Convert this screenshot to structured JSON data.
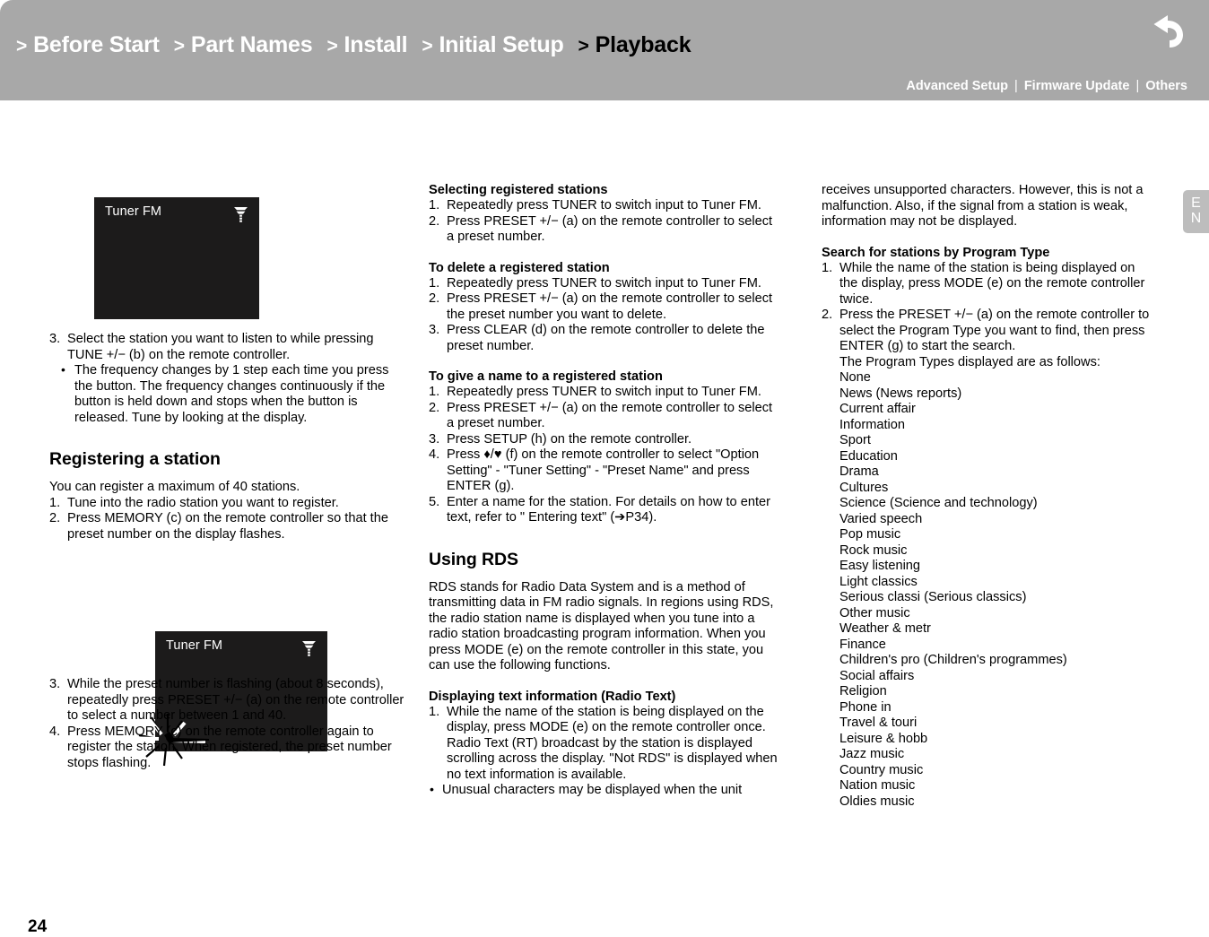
{
  "header": {
    "breadcrumbs": [
      {
        "label": "Before Start",
        "chevron": ">",
        "active": false
      },
      {
        "label": "Part Names",
        "chevron": ">",
        "active": false
      },
      {
        "label": "Install",
        "chevron": ">",
        "active": false
      },
      {
        "label": "Initial Setup",
        "chevron": ">",
        "active": false
      },
      {
        "label": "Playback",
        "chevron": ">",
        "active": true
      }
    ],
    "links": [
      {
        "label": "Advanced Setup"
      },
      {
        "label": "Firmware Update"
      },
      {
        "label": "Others"
      }
    ],
    "link_separator": "|",
    "back_icon": "back-arrow-icon",
    "bg_color": "#a8a8a8",
    "text_color": "#ffffff",
    "active_color": "#000000"
  },
  "side_tab": {
    "line1": "E",
    "line2": "N",
    "bg_color": "#bdbdbd"
  },
  "figures": {
    "figure1": {
      "label": "Tuner FM",
      "icon": "antenna-signal-icon"
    },
    "figure2": {
      "label": "Tuner FM",
      "icon": "antenna-signal-icon",
      "effect": "flashing-sparkle"
    }
  },
  "left_column": {
    "step3": {
      "num": "3.",
      "text": "Select the station you want to listen to while pressing TUNE +/− (b) on the remote controller."
    },
    "step3_bullet": "The frequency changes by 1 step each time you press the button. The frequency changes continuously if the button is held down and stops when the button is released. Tune by looking at the display.",
    "registering_heading": "Registering a station",
    "registering_intro": "You can register a maximum of 40 stations.",
    "registering_steps": [
      {
        "num": "1.",
        "text": "Tune into the radio station you want to register."
      },
      {
        "num": "2.",
        "text": "Press MEMORY (c) on the remote controller so that the preset number on the display flashes."
      }
    ],
    "registering_steps_after": [
      {
        "num": "3.",
        "text": "While the preset number is flashing (about 8 seconds), repeatedly press PRESET +/− (a) on the remote controller to select a number between 1 and 40."
      },
      {
        "num": "4.",
        "text": "Press MEMORY (c) on the remote controller again to register the station. When registered, the preset number stops flashing."
      }
    ]
  },
  "middle_column": {
    "selecting_heading": "Selecting registered stations",
    "selecting_steps": [
      {
        "num": "1.",
        "text": "Repeatedly press TUNER to switch input to Tuner FM."
      },
      {
        "num": "2.",
        "text": "Press PRESET +/− (a) on the remote controller to select a preset number."
      }
    ],
    "delete_heading": "To delete a registered station",
    "delete_steps": [
      {
        "num": "1.",
        "text": "Repeatedly press TUNER to switch input to Tuner FM."
      },
      {
        "num": "2.",
        "text": "Press PRESET +/− (a) on the remote controller to select the preset number you want to delete."
      },
      {
        "num": "3.",
        "text": "Press CLEAR (d) on the remote controller to delete the preset number."
      }
    ],
    "name_heading": "To give a name to a registered station",
    "name_steps": [
      {
        "num": "1.",
        "text": "Repeatedly press TUNER to switch input to Tuner FM."
      },
      {
        "num": "2.",
        "text": "Press PRESET +/− (a) on the remote controller to select a preset number."
      },
      {
        "num": "3.",
        "text": "Press SETUP (h) on the remote controller."
      },
      {
        "num": "4.",
        "text": "Press ♦/♥ (f) on the remote controller to select \"Option Setting\" - \"Tuner Setting\" - \"Preset Name\" and press ENTER (g)."
      },
      {
        "num": "5.",
        "text": "Enter a name for the station. For details on how to enter text, refer to \" Entering text\" (➔P34)."
      }
    ],
    "rds_heading": "Using RDS",
    "rds_body": "RDS stands for Radio Data System and is a method of transmitting data in FM radio signals. In regions using RDS, the radio station name is displayed when you tune into a radio station broadcasting program information. When you press MODE (e) on the remote controller in this state, you can use the following functions.",
    "radiotext_heading": "Displaying text information (Radio Text)",
    "radiotext_step1": {
      "num": "1.",
      "text": "While the name of the station is being displayed on the display, press MODE (e) on the remote controller once. Radio Text (RT) broadcast by the station is displayed scrolling across the display. \"Not RDS\" is displayed when no text information is available."
    },
    "radiotext_bullet_part1": "Unusual characters may be displayed when the unit"
  },
  "right_column": {
    "continued_text": "receives unsupported characters. However, this is not a malfunction. Also, if the signal from a station is weak, information may not be displayed.",
    "program_type_heading": "Search for stations by Program Type",
    "program_type_steps": [
      {
        "num": "1.",
        "text": "While the name of the station is being displayed on the display, press MODE (e) on the remote controller twice."
      },
      {
        "num": "2.",
        "text": "Press the PRESET +/− (a) on the remote controller to select the Program Type you want to find, then press ENTER (g) to start the search."
      }
    ],
    "program_type_intro": "The Program Types displayed are as follows:",
    "program_types": [
      "None",
      "News (News reports)",
      "Current affair",
      "Information",
      "Sport",
      "Education",
      "Drama",
      "Cultures",
      "Science (Science and technology)",
      "Varied speech",
      "Pop music",
      "Rock music",
      "Easy listening",
      "Light classics",
      "Serious classi (Serious classics)",
      "Other music",
      "Weather & metr",
      "Finance",
      "Children's pro (Children's programmes)",
      "Social affairs",
      "Religion",
      "Phone in",
      "Travel & touri",
      "Leisure & hobb",
      "Jazz music",
      "Country music",
      "Nation music",
      "Oldies music"
    ]
  },
  "footer": {
    "page_number": "24"
  }
}
